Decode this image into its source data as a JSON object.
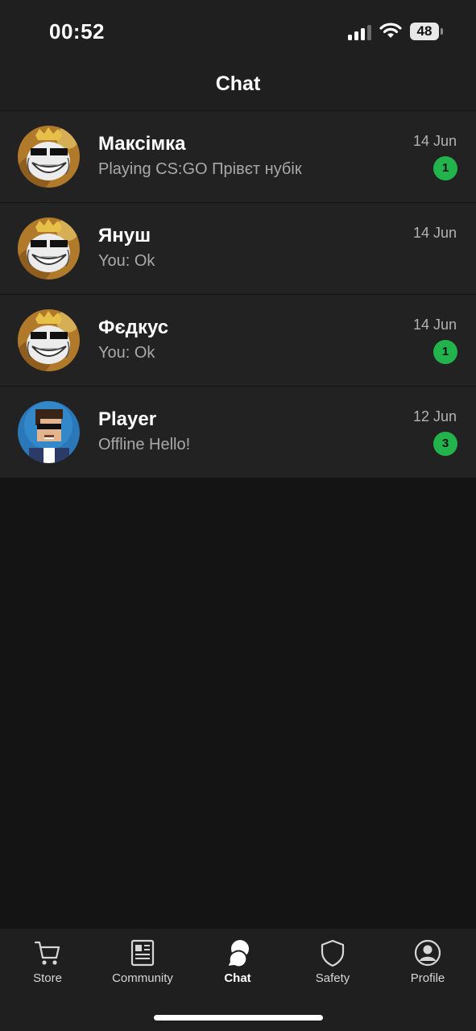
{
  "status_bar": {
    "time": "00:52",
    "battery_level": "48",
    "signal_bars": 3,
    "icons": [
      "cellular-signal-icon",
      "wifi-icon",
      "battery-icon"
    ]
  },
  "header": {
    "title": "Chat"
  },
  "chats": [
    {
      "name": "Максімка",
      "preview": "Playing CS:GO Прівєт нубік",
      "date": "14 Jun",
      "unread": "1",
      "avatar": "troll-face-crown-avatar"
    },
    {
      "name": "Януш",
      "preview": "You: Ok",
      "date": "14 Jun",
      "unread": null,
      "avatar": "troll-face-crown-avatar"
    },
    {
      "name": "Фєдкус",
      "preview": "You: Ok",
      "date": "14 Jun",
      "unread": "1",
      "avatar": "troll-face-crown-avatar"
    },
    {
      "name": "Player",
      "preview": "Offline Hello!",
      "date": "12 Jun",
      "unread": "3",
      "avatar": "blocky-character-avatar"
    }
  ],
  "tabs": [
    {
      "label": "Store",
      "icon": "cart-icon",
      "active": false
    },
    {
      "label": "Community",
      "icon": "newspaper-icon",
      "active": false
    },
    {
      "label": "Chat",
      "icon": "chat-bubbles-icon",
      "active": true
    },
    {
      "label": "Safety",
      "icon": "shield-icon",
      "active": false
    },
    {
      "label": "Profile",
      "icon": "user-circle-icon",
      "active": false
    }
  ],
  "colors": {
    "background": "#141414",
    "surface": "#222222",
    "unread_badge": "#22b34c",
    "secondary_text": "#a9a9a9"
  }
}
